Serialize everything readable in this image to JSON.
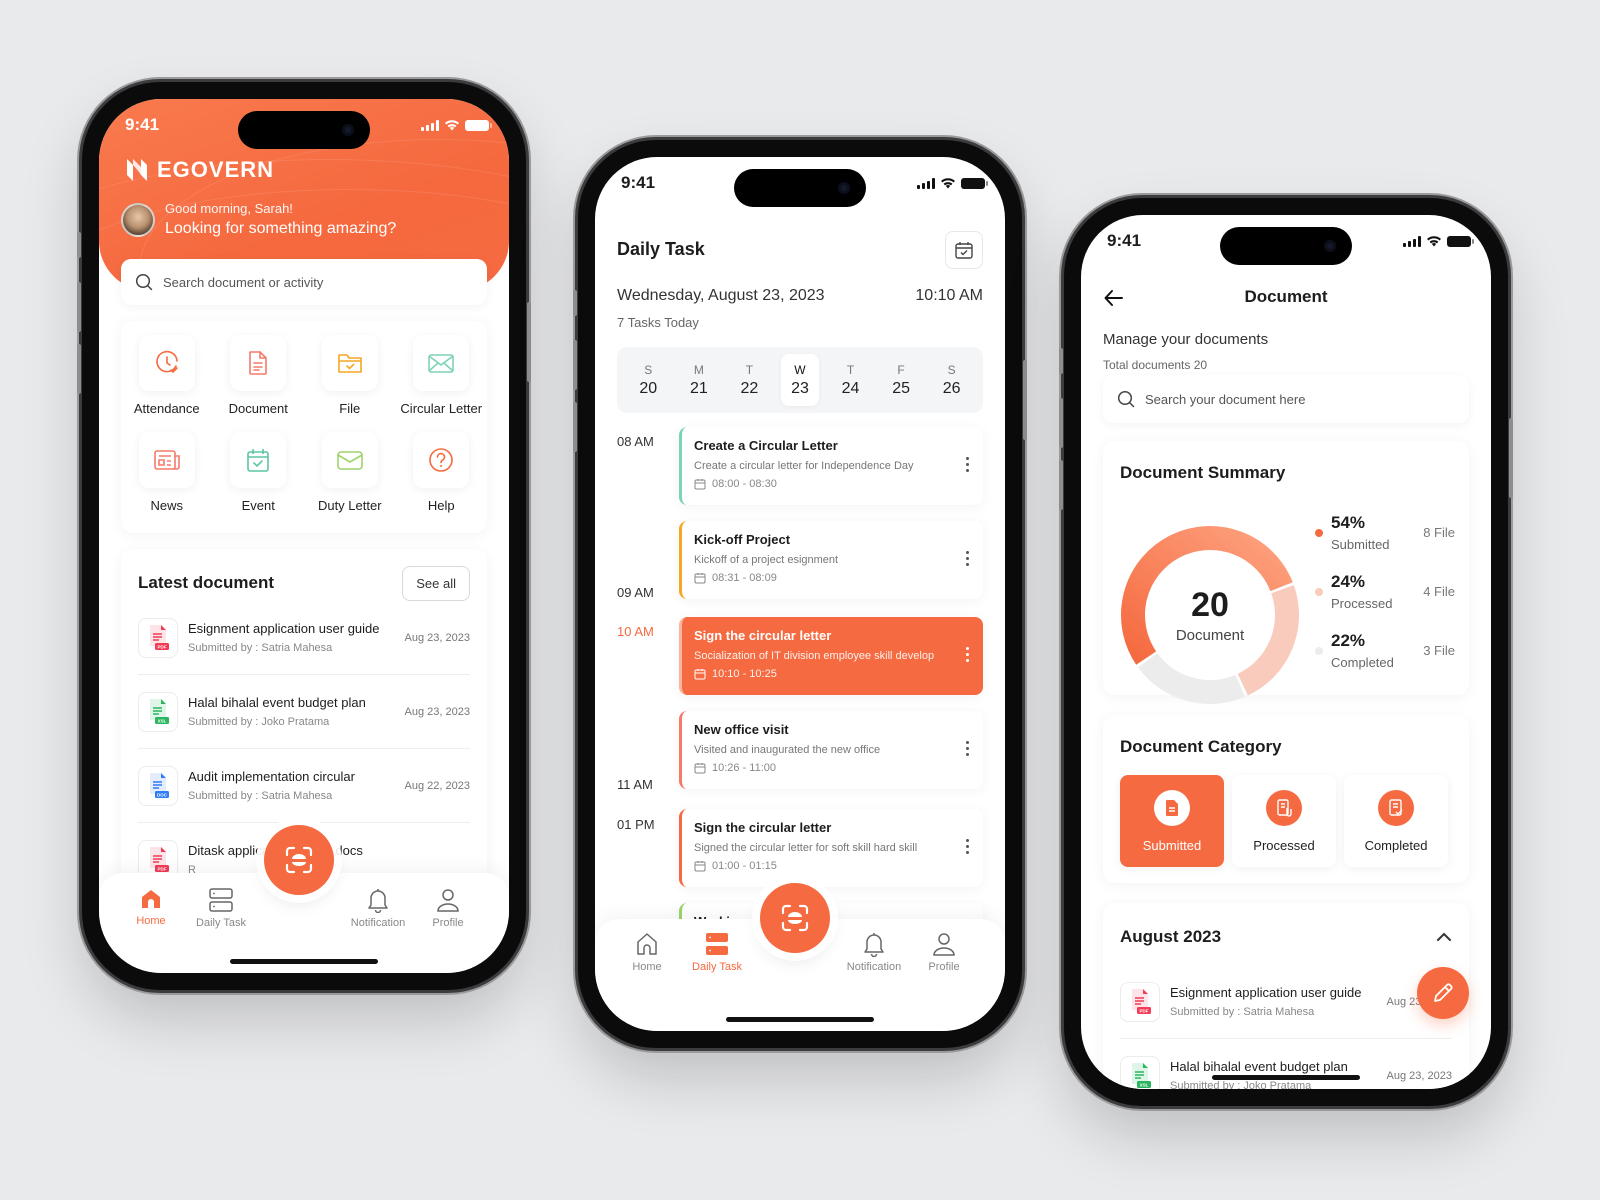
{
  "colors": {
    "accent": "#f56a40",
    "teal": "#7dd3b6",
    "amber": "#f5a623",
    "salmon": "#f57a6a",
    "green": "#9ed36a",
    "processed": "#f9cbbd",
    "completed": "#ececec"
  },
  "status_bar": {
    "time": "9:41"
  },
  "home": {
    "brand": "EGOVERN",
    "greeting": "Good morning, Sarah!",
    "prompt": "Looking for something amazing?",
    "search_placeholder": "Search document or activity",
    "menu": [
      {
        "label": "Attendance",
        "icon": "clock-check-icon"
      },
      {
        "label": "Document",
        "icon": "document-icon"
      },
      {
        "label": "File",
        "icon": "folder-check-icon"
      },
      {
        "label": "Circular Letter",
        "icon": "envelope-icon"
      },
      {
        "label": "News",
        "icon": "newspaper-icon"
      },
      {
        "label": "Event",
        "icon": "calendar-check-icon"
      },
      {
        "label": "Duty Letter",
        "icon": "mail-icon"
      },
      {
        "label": "Help",
        "icon": "help-circle-icon"
      }
    ],
    "latest": {
      "title": "Latest document",
      "see_all": "See all",
      "items": [
        {
          "name": "Esignment application user guide",
          "by": "Submitted by : Satria Mahesa",
          "date": "Aug 23, 2023",
          "type": "PDF"
        },
        {
          "name": "Halal bihalal event budget plan",
          "by": "Submitted by : Joko Pratama",
          "date": "Aug 23, 2023",
          "type": "XSL"
        },
        {
          "name": "Audit implementation circular",
          "by": "Submitted by : Satria Mahesa",
          "date": "Aug 22, 2023",
          "type": "DOC"
        },
        {
          "name": "Ditask application testing docs",
          "by": "R",
          "date": "",
          "type": "PDF"
        }
      ]
    }
  },
  "tabs": [
    {
      "label": "Home",
      "icon": "home-icon"
    },
    {
      "label": "Daily Task",
      "icon": "tasks-icon"
    },
    {
      "label": "Notification",
      "icon": "bell-icon"
    },
    {
      "label": "Profile",
      "icon": "user-icon"
    }
  ],
  "daily": {
    "title": "Daily Task",
    "date": "Wednesday, August 23, 2023",
    "clock": "10:10 AM",
    "count": "7 Tasks Today",
    "week": [
      {
        "w": "S",
        "n": "20"
      },
      {
        "w": "M",
        "n": "21"
      },
      {
        "w": "T",
        "n": "22"
      },
      {
        "w": "W",
        "n": "23",
        "active": true
      },
      {
        "w": "T",
        "n": "24"
      },
      {
        "w": "F",
        "n": "25"
      },
      {
        "w": "S",
        "n": "26"
      }
    ],
    "hours": [
      "08 AM",
      "09 AM",
      "10 AM",
      "11 AM",
      "01 PM"
    ],
    "tasks": [
      {
        "title": "Create a Circular Letter",
        "desc": "Create a circular letter for Independence Day",
        "time": "08:00 - 08:30",
        "color": "#7dd3b6"
      },
      {
        "title": "Kick-off Project",
        "desc": "Kickoff of a project esignment",
        "time": "08:31 - 08:09",
        "color": "#f5a623"
      },
      {
        "title": "Sign the circular letter",
        "desc": "Socialization of IT division employee skill develop",
        "time": "10:10 - 10:25",
        "color": "#f9b69f",
        "active": true
      },
      {
        "title": "New office visit",
        "desc": "Visited and inaugurated the new office",
        "time": "10:26 - 11:00",
        "color": "#f57a6a"
      },
      {
        "title": "Sign the circular letter",
        "desc": "Signed the circular letter for soft skill hard skill",
        "time": "01:00 - 01:15",
        "color": "#f56a40"
      },
      {
        "title": "Working on",
        "desc": "",
        "time": "",
        "color": "#9ed36a"
      }
    ]
  },
  "document": {
    "title": "Document",
    "subtitle": "Manage your documents",
    "total": "Total documents 20",
    "search_placeholder": "Search your document here",
    "summary": {
      "title": "Document Summary",
      "center_value": "20",
      "center_label": "Document",
      "items": [
        {
          "pct": "54%",
          "label": "Submitted",
          "files": "8 File",
          "value": 54
        },
        {
          "pct": "24%",
          "label": "Processed",
          "files": "4 File",
          "value": 24
        },
        {
          "pct": "22%",
          "label": "Completed",
          "files": "3 File",
          "value": 22
        }
      ]
    },
    "category": {
      "title": "Document Category",
      "items": [
        {
          "label": "Submitted",
          "active": true
        },
        {
          "label": "Processed"
        },
        {
          "label": "Completed"
        }
      ]
    },
    "month": {
      "title": "August 2023",
      "items": [
        {
          "name": "Esignment application user guide",
          "by": "Submitted by : Satria Mahesa",
          "date": "Aug 23, 2023",
          "type": "PDF"
        },
        {
          "name": "Halal bihalal event budget plan",
          "by": "Submitted by : Joko Pratama",
          "date": "Aug 23, 2023",
          "type": "XSL"
        }
      ]
    }
  }
}
